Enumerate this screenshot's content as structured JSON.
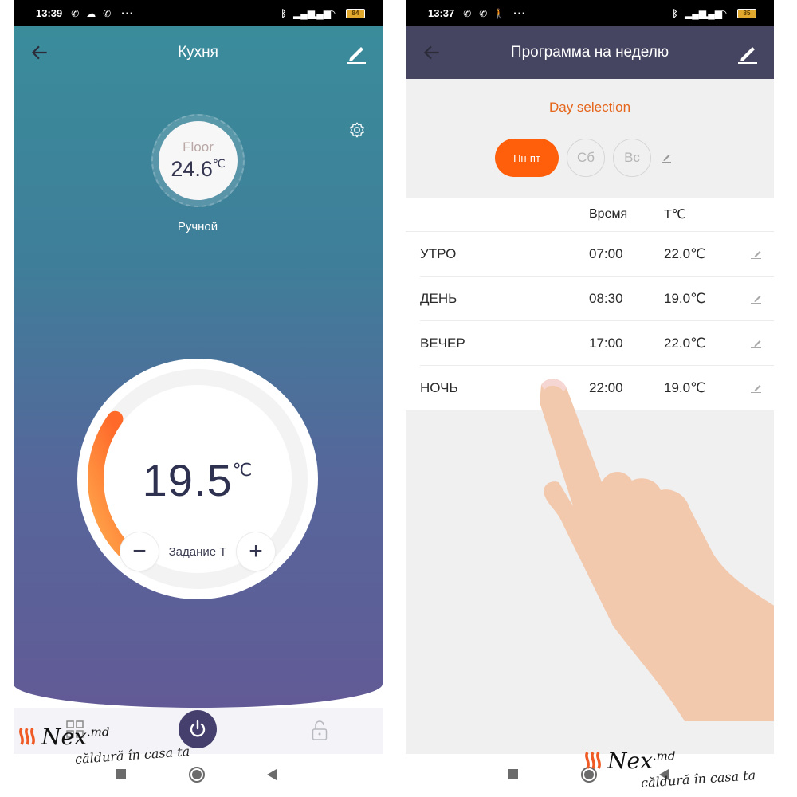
{
  "left_screen": {
    "statusbar": {
      "time": "13:39",
      "left_icons": [
        "viber-icon",
        "cloud-icon",
        "viber-icon"
      ],
      "more": "···",
      "battery": "84"
    },
    "header": {
      "title": "Кухня"
    },
    "floor_sensor": {
      "label": "Floor",
      "value": "24.6",
      "unit": "℃"
    },
    "mode": "Ручной",
    "setpoint_dial": {
      "value": "19.5",
      "unit": "℃",
      "label": "Задание T",
      "minus": "−",
      "plus": "+",
      "arc_fill_fraction": 0.3,
      "colors": {
        "arc_start": "#ffa94d",
        "arc_end": "#ff6a2a"
      }
    },
    "bottom_nav": [
      "grid-icon",
      "power-icon",
      "unlock-icon"
    ]
  },
  "right_screen": {
    "statusbar": {
      "time": "13:37",
      "left_icons": [
        "viber-icon",
        "viber-icon",
        "walking-icon"
      ],
      "more": "···",
      "battery": "85"
    },
    "header": {
      "title": "Программа на неделю"
    },
    "day_selection": {
      "title": "Day selection",
      "days": [
        {
          "label": "Пн-пт",
          "active": true
        },
        {
          "label": "Сб",
          "active": false
        },
        {
          "label": "Вс",
          "active": false
        }
      ]
    },
    "schedule": {
      "columns": [
        "",
        "Время",
        "T℃"
      ],
      "rows": [
        {
          "name": "УТРО",
          "time": "07:00",
          "temp": "22.0℃"
        },
        {
          "name": "ДЕНЬ",
          "time": "08:30",
          "temp": "19.0℃"
        },
        {
          "name": "ВЕЧЕР",
          "time": "17:00",
          "temp": "22.0℃"
        },
        {
          "name": "НОЧЬ",
          "time": "22:00",
          "temp": "19.0℃"
        }
      ]
    }
  },
  "watermark": {
    "brand": "Nex",
    "brand_suffix": ".md",
    "slogan": "căldură în casa ta"
  },
  "colors": {
    "accent_orange": "#ff5e0a",
    "header_right": "#454562",
    "day_title": "#e5661c"
  }
}
